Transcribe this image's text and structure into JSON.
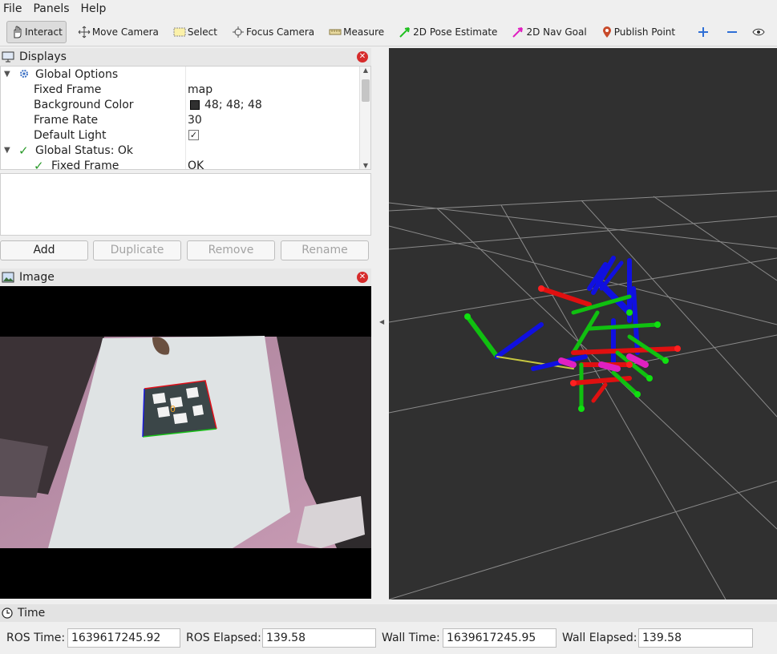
{
  "menu": [
    "File",
    "Panels",
    "Help"
  ],
  "toolbar": {
    "interact": "Interact",
    "move_camera": "Move Camera",
    "select": "Select",
    "focus_camera": "Focus Camera",
    "measure": "Measure",
    "pose_estimate": "2D Pose Estimate",
    "nav_goal": "2D Nav Goal",
    "publish_point": "Publish Point"
  },
  "displays": {
    "title": "Displays",
    "rows": {
      "global_options": "Global Options",
      "fixed_frame": {
        "key": "Fixed Frame",
        "value": "map"
      },
      "background_color": {
        "key": "Background Color",
        "value": "48; 48; 48",
        "swatch": "#303030"
      },
      "frame_rate": {
        "key": "Frame Rate",
        "value": "30"
      },
      "default_light": {
        "key": "Default Light",
        "value": "✓"
      },
      "global_status": "Global Status: Ok",
      "status_fixed_frame": {
        "key": "Fixed Frame",
        "value": "OK"
      }
    },
    "buttons": {
      "add": "Add",
      "duplicate": "Duplicate",
      "remove": "Remove",
      "rename": "Rename"
    }
  },
  "image_panel": {
    "title": "Image"
  },
  "time": {
    "title": "Time",
    "ros_time_label": "ROS Time:",
    "ros_time": "1639617245.92",
    "ros_elapsed_label": "ROS Elapsed:",
    "ros_elapsed": "139.58",
    "wall_time_label": "Wall Time:",
    "wall_time": "1639617245.95",
    "wall_elapsed_label": "Wall Elapsed:",
    "wall_elapsed": "139.58"
  },
  "colors": {
    "viewport_bg": "#303030",
    "x_axis": "#ff0000",
    "y_axis": "#00ff00",
    "z_axis": "#0000ff",
    "close": "#d62b2b"
  }
}
